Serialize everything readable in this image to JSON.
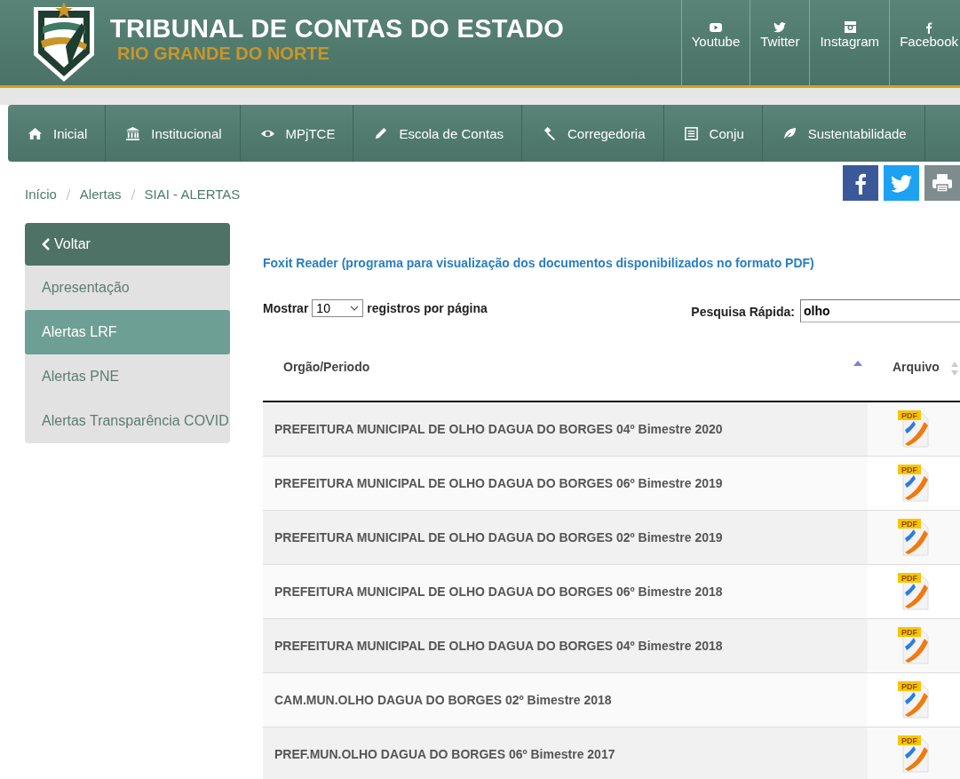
{
  "header": {
    "title": "TRIBUNAL DE CONTAS DO ESTADO",
    "subtitle": "RIO GRANDE DO NORTE",
    "social": [
      {
        "kind": "youtube",
        "label": "Youtube"
      },
      {
        "kind": "twitter",
        "label": "Twitter"
      },
      {
        "kind": "instagram",
        "label": "Instagram"
      },
      {
        "kind": "facebook",
        "label": "Facebook"
      }
    ]
  },
  "nav": [
    {
      "kind": "home",
      "label": "Inicial"
    },
    {
      "kind": "bank",
      "label": "Institucional"
    },
    {
      "kind": "eye",
      "label": "MPjTCE"
    },
    {
      "kind": "pencil",
      "label": "Escola de Contas"
    },
    {
      "kind": "gavel",
      "label": "Corregedoria"
    },
    {
      "kind": "list",
      "label": "Conju"
    },
    {
      "kind": "leaf",
      "label": "Sustentabilidade"
    }
  ],
  "breadcrumb": [
    "Início",
    "Alertas",
    "SIAI - ALERTAS"
  ],
  "share": [
    {
      "kind": "facebook"
    },
    {
      "kind": "twitter"
    },
    {
      "kind": "print"
    }
  ],
  "sidebar": {
    "back": "Voltar",
    "items": [
      {
        "label": "Apresentação",
        "selected": false
      },
      {
        "label": "Alertas LRF",
        "selected": true
      },
      {
        "label": "Alertas PNE",
        "selected": false
      },
      {
        "label": "Alertas Transparência COVID",
        "selected": false
      }
    ]
  },
  "main": {
    "link": "Foxit Reader (programa para visualização dos documentos disponibilizados no formato PDF)",
    "length": {
      "before": "Mostrar",
      "value": "10",
      "after": "registros por página"
    },
    "search": {
      "label": "Pesquisa Rápida:",
      "value": "olho"
    },
    "table": {
      "columns": [
        {
          "label": "Orgão/Periodo",
          "sorted": true
        },
        {
          "label": "Arquivo",
          "sorted": false
        }
      ],
      "rows": [
        {
          "name": "PREFEITURA MUNICIPAL DE OLHO DAGUA DO BORGES 04º Bimestre 2020",
          "file": "PDF"
        },
        {
          "name": "PREFEITURA MUNICIPAL DE OLHO DAGUA DO BORGES 06º Bimestre 2019",
          "file": "PDF"
        },
        {
          "name": "PREFEITURA MUNICIPAL DE OLHO DAGUA DO BORGES 02º Bimestre 2019",
          "file": "PDF"
        },
        {
          "name": "PREFEITURA MUNICIPAL DE OLHO DAGUA DO BORGES 06º Bimestre 2018",
          "file": "PDF"
        },
        {
          "name": "PREFEITURA MUNICIPAL DE OLHO DAGUA DO BORGES 04º Bimestre 2018",
          "file": "PDF"
        },
        {
          "name": "CAM.MUN.OLHO DAGUA DO BORGES 02º Bimestre 2018",
          "file": "PDF"
        },
        {
          "name": "PREF.MUN.OLHO DAGUA DO BORGES 06º Bimestre 2017",
          "file": "PDF"
        }
      ]
    }
  }
}
